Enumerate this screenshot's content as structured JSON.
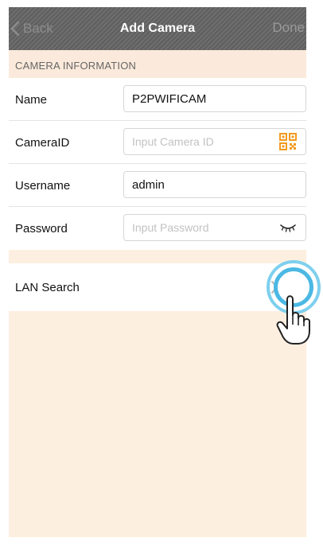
{
  "nav": {
    "back_label": "Back",
    "title": "Add Camera",
    "done_label": "Done"
  },
  "section": {
    "header": "CAMERA INFORMATION"
  },
  "fields": {
    "name": {
      "label": "Name",
      "value": "P2PWIFICAM",
      "placeholder": ""
    },
    "camera_id": {
      "label": "CameraID",
      "value": "",
      "placeholder": "Input Camera ID",
      "icon": "qr-code-icon"
    },
    "username": {
      "label": "Username",
      "value": "admin",
      "placeholder": ""
    },
    "password": {
      "label": "Password",
      "value": "",
      "placeholder": "Input Password",
      "icon": "eye-closed-icon"
    }
  },
  "lan": {
    "label": "LAN Search",
    "icon": "chevron-right-icon"
  },
  "colors": {
    "accent": "#f29a1e",
    "highlight_ring": "#4bb8e4",
    "background": "#fdefe0"
  }
}
